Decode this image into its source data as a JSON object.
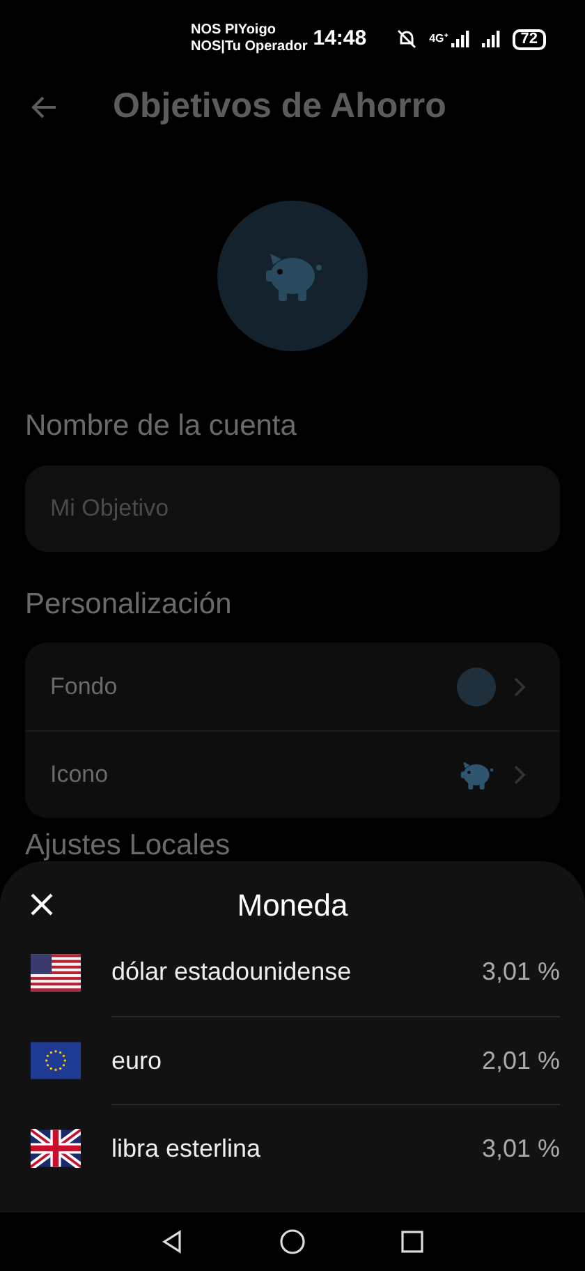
{
  "status_bar": {
    "carriers": [
      "NOS PIYoigo",
      "NOS|Tu Operador"
    ],
    "time": "14:48",
    "network": "4G⁺",
    "battery": "72"
  },
  "header": {
    "title": "Objetivos de Ahorro"
  },
  "account_name": {
    "label": "Nombre de la cuenta",
    "placeholder": "Mi Objetivo"
  },
  "personalization": {
    "label": "Personalización",
    "items": [
      {
        "kind": "color",
        "label": "Fondo",
        "color": "#1f2f3b"
      },
      {
        "kind": "icon",
        "label": "Icono",
        "color": "#2f5470"
      }
    ]
  },
  "local_settings": {
    "label": "Ajustes Locales"
  },
  "sheet": {
    "title": "Moneda",
    "currencies": [
      {
        "kind": "us",
        "name": "dólar estadounidense",
        "rate": "3,01 %"
      },
      {
        "kind": "eu",
        "name": "euro",
        "rate": "2,01 %"
      },
      {
        "kind": "gb",
        "name": "libra esterlina",
        "rate": "3,01 %"
      }
    ]
  }
}
